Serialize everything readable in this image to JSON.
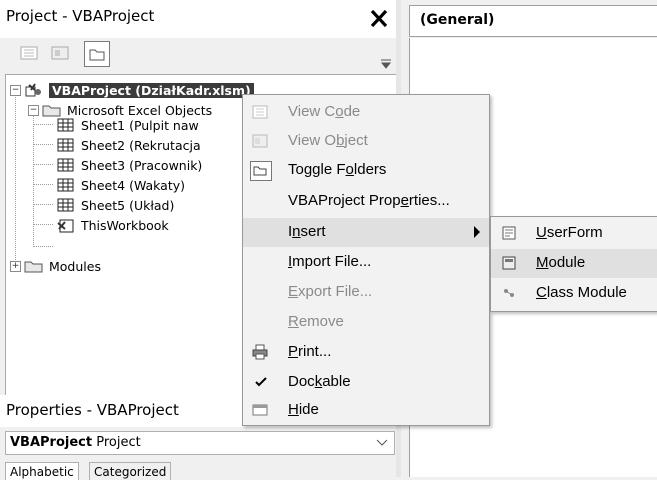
{
  "project_panel": {
    "title": "Project - VBAProject",
    "tree": {
      "root": {
        "label": "VBAProject (DziałKadr.xlsm)"
      },
      "excel_objects": {
        "label": "Microsoft Excel Objects"
      },
      "sheets": [
        {
          "label": "Sheet1 (Pulpit naw"
        },
        {
          "label": "Sheet2 (Rekrutacja"
        },
        {
          "label": "Sheet3 (Pracownik)"
        },
        {
          "label": "Sheet4 (Wakaty)"
        },
        {
          "label": "Sheet5 (Układ)"
        }
      ],
      "workbook": {
        "label": "ThisWorkbook"
      },
      "modules": {
        "label": "Modules"
      }
    }
  },
  "properties_panel": {
    "title": "Properties - VBAProject",
    "object_name": "VBAProject",
    "object_type": "Project",
    "tabs": [
      "Alphabetic",
      "Categorized"
    ]
  },
  "code_window": {
    "object_combo": "(General)"
  },
  "context_menu": {
    "items": [
      {
        "pre": "View C",
        "acc": "o",
        "post": "de",
        "enabled": false
      },
      {
        "pre": "View O",
        "acc": "b",
        "post": "ject",
        "enabled": false
      },
      {
        "pre": "Toggle F",
        "acc": "o",
        "post": "lders",
        "enabled": true
      },
      {
        "pre": "VBAProject Prop",
        "acc": "e",
        "post": "rties...",
        "enabled": true
      },
      {
        "pre": "I",
        "acc": "n",
        "post": "sert",
        "enabled": true
      },
      {
        "pre": "",
        "acc": "I",
        "post": "mport File...",
        "enabled": true
      },
      {
        "pre": "",
        "acc": "E",
        "post": "xport File...",
        "enabled": false
      },
      {
        "pre": "",
        "acc": "R",
        "post": "emove",
        "enabled": false
      },
      {
        "pre": "",
        "acc": "P",
        "post": "rint...",
        "enabled": true
      },
      {
        "pre": "Doc",
        "acc": "k",
        "post": "able",
        "enabled": true,
        "checked": true
      },
      {
        "pre": "",
        "acc": "H",
        "post": "ide",
        "enabled": true
      }
    ]
  },
  "insert_submenu": {
    "items": [
      {
        "acc": "U",
        "post": "serForm"
      },
      {
        "acc": "M",
        "post": "odule"
      },
      {
        "acc": "C",
        "post": "lass Module"
      }
    ]
  }
}
